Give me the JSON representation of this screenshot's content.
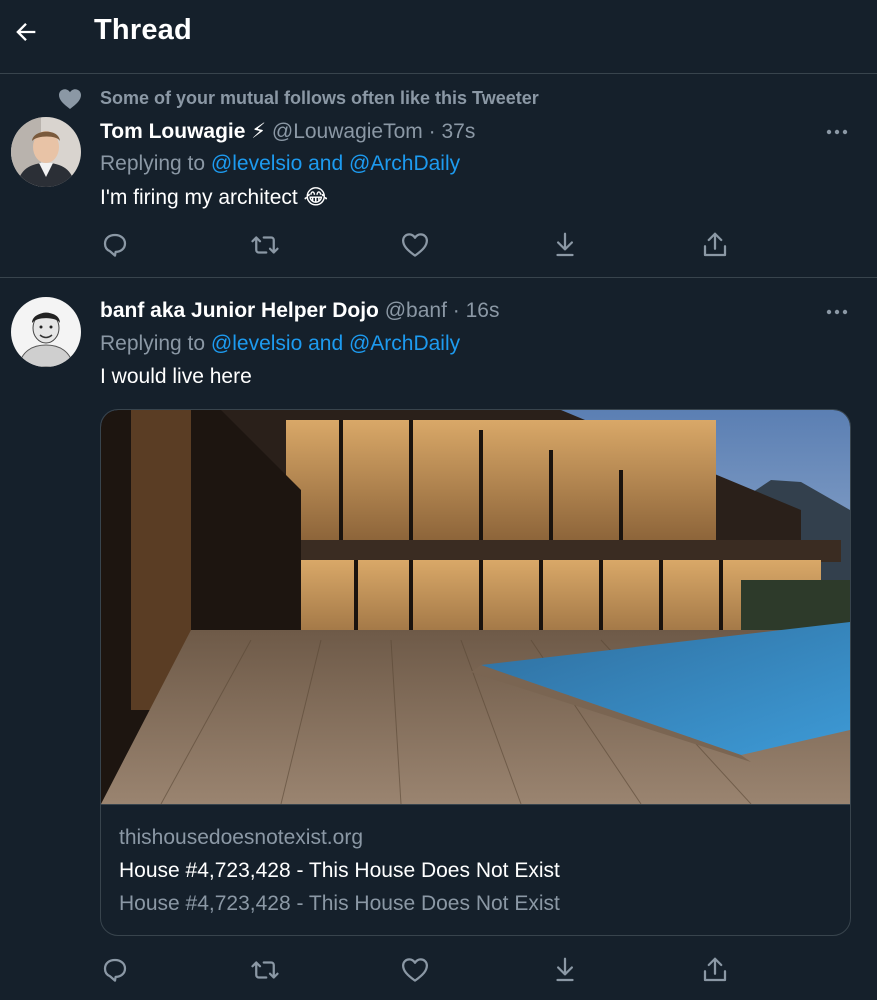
{
  "header": {
    "title": "Thread"
  },
  "social_context": "Some of your mutual follows often like this Tweeter",
  "tweets": [
    {
      "name": "Tom Louwagie ⚡",
      "handle": "@LouwagieTom",
      "dot": "·",
      "time": "37s",
      "replying_prefix": "Replying to ",
      "replying_to": "@levelsio and @ArchDaily",
      "text": "I'm firing my architect 😂"
    },
    {
      "name": "banf aka Junior Helper Dojo",
      "handle": "@banf",
      "dot": "·",
      "time": "16s",
      "replying_prefix": "Replying to ",
      "replying_to": "@levelsio and @ArchDaily",
      "text": "I would live here",
      "card": {
        "domain": "thishousedoesnotexist.org",
        "title": "House #4,723,428 - This House Does Not Exist",
        "description": "House #4,723,428 - This House Does Not Exist"
      }
    }
  ],
  "icons": [
    "back-arrow-icon",
    "heart-icon",
    "more-icon",
    "reply-icon",
    "retweet-icon",
    "like-icon",
    "download-icon",
    "share-icon"
  ],
  "colors": {
    "background": "#15202b",
    "text": "#ffffff",
    "secondary": "#8b98a5",
    "link": "#1d9bf0",
    "border": "#38444d"
  }
}
